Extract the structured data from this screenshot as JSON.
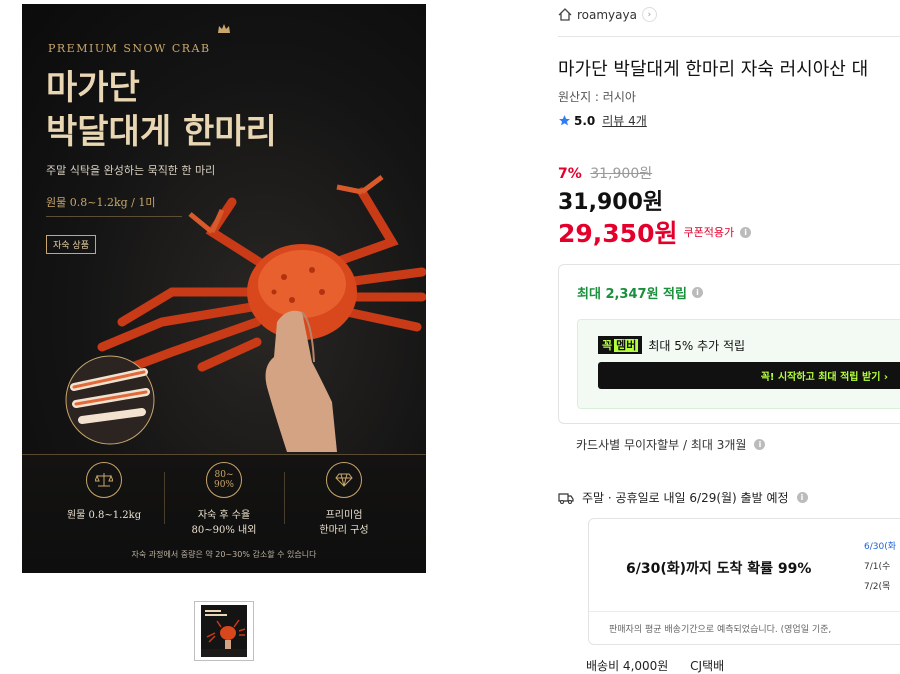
{
  "poster": {
    "badge": "PREMIUM SNOW CRAB",
    "title_line1": "마가단",
    "title_line2": "박달대게 한마리",
    "subtitle": "주말 식탁을 완성하는 묵직한 한 마리",
    "weight": "원물 0.8~1.2kg / 1미",
    "tag": "자숙 상품",
    "features": [
      {
        "icon_text": "",
        "icon": "scale-icon",
        "caption_line1": "원물 0.8~1.2kg",
        "caption_line2": ""
      },
      {
        "icon_text": "80~ 90%",
        "icon": "percent-ring",
        "caption_line1": "자숙 후 수율",
        "caption_line2": "80~90% 내외"
      },
      {
        "icon_text": "",
        "icon": "diamond-icon",
        "caption_line1": "프리미엄",
        "caption_line2": "한마리 구성"
      }
    ],
    "footnote": "자숙 과정에서 중량은 약 20~30% 감소할 수 있습니다"
  },
  "store": {
    "name": "roamyaya",
    "icon": "home-icon"
  },
  "product": {
    "title": "마가단 박달대게 한마리 자숙 러시아산 대",
    "origin": "원산지 : 러시아",
    "rating": "5.0",
    "reviews": "리뷰 4개",
    "discount_pct": "7%",
    "original_price": "31,900원",
    "price": "31,900원",
    "coupon_price": "29,350원",
    "coupon_label": "쿠폰적용가"
  },
  "benefits": {
    "points": "최대 2,347원 적립",
    "member_logo": "꼭",
    "member_logo2": "멤버",
    "member_text": "최대 5% 추가 적립",
    "member_cta": "꼭! 시작하고 최대 적립 받기 ›",
    "card_installment": "카드사별 무이자할부 / 최대 3개월"
  },
  "shipping": {
    "notice": "주말 · 공휴일로 내일 6/29(월) 출발 예정",
    "arrival": "6/30(화)까지 도착 확률 99%",
    "dates": [
      "6/30(화",
      "7/1(수",
      "7/2(목"
    ],
    "note": "판매자의 평균 배송기간으로 예측되었습니다. (영업일 기준,",
    "fee": "배송비 4,000원",
    "courier": "CJ택배"
  },
  "colors": {
    "accent_red": "#e4002b",
    "points_green": "#1a8f3c",
    "gold": "#c9a66b"
  }
}
